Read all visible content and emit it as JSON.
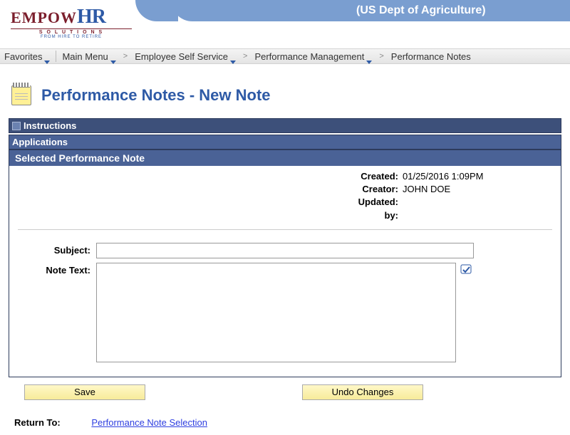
{
  "header": {
    "org": "(US Dept of Agriculture)",
    "logo_main_a": "EMPOW",
    "logo_main_b": "HR",
    "logo_sub": "S O L U T I O N S",
    "logo_tag": "FROM HIRE TO RETIRE"
  },
  "breadcrumb": {
    "favorites": "Favorites",
    "main_menu": "Main Menu",
    "items": [
      "Employee Self Service",
      "Performance Management",
      "Performance Notes"
    ]
  },
  "page": {
    "title": "Performance Notes - New Note",
    "instructions_label": "Instructions",
    "applications_label": "Applications",
    "selected_note_label": "Selected Performance Note"
  },
  "meta": {
    "created_label": "Created:",
    "created_value": "01/25/2016  1:09PM",
    "creator_label": "Creator:",
    "creator_value": "JOHN DOE",
    "updated_label": "Updated:",
    "updated_value": "",
    "by_label": "by:",
    "by_value": ""
  },
  "fields": {
    "subject_label": "Subject:",
    "subject_value": "",
    "note_label": "Note Text:",
    "note_value": ""
  },
  "buttons": {
    "save": "Save",
    "undo": "Undo Changes"
  },
  "return": {
    "label": "Return To:",
    "link": "Performance Note Selection"
  }
}
